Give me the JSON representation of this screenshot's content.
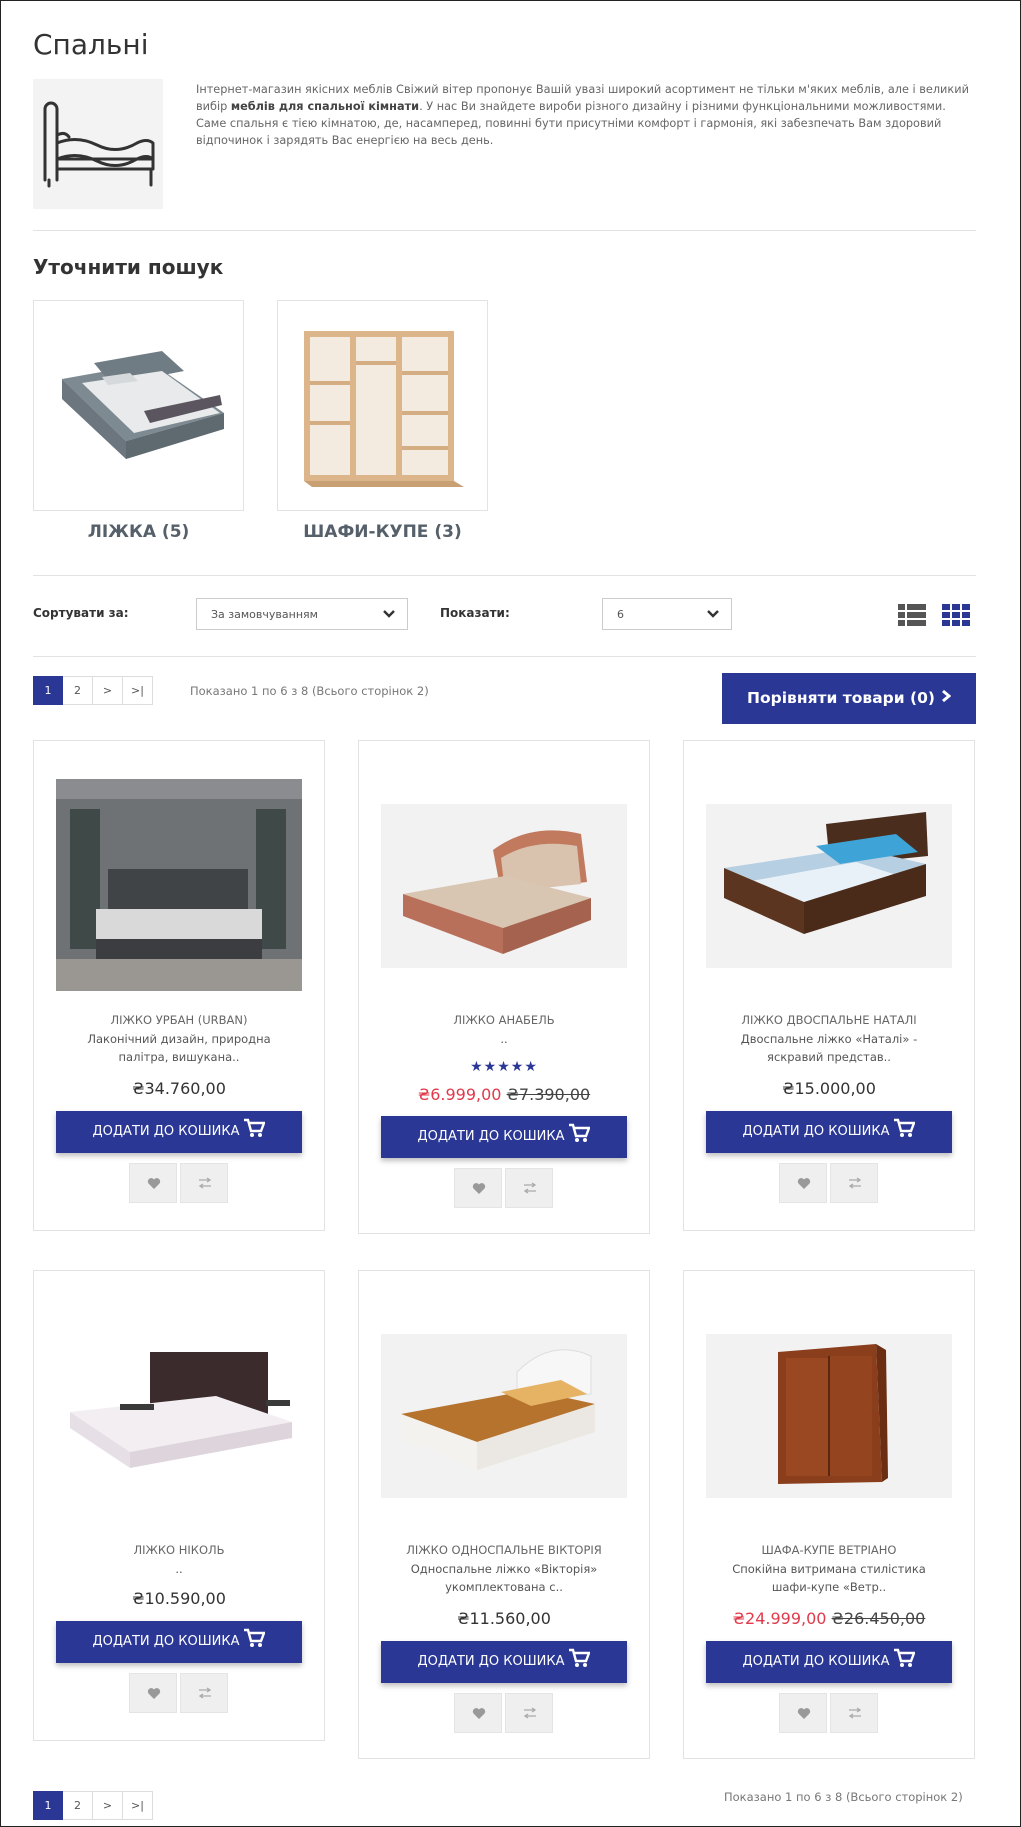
{
  "category": {
    "title": "Спальні",
    "desc_part1": "Інтернет-магазин якісних меблів Свіжий вітер пропонує Вашій увазі широкий асортимент не тільки м'яких меблів, але і великий вибір ",
    "desc_bold": "меблів для спальної кімнати",
    "desc_part2": ". У нас Ви знайдете вироби різного дизайну і різними функціональними можливостями.",
    "desc_para2": "Саме спальня є тією кімнатою, де, насамперед, повинні бути присутніми комфорт і гармонія, які забезпечать Вам здоровий відпочинок і зарядять Вас енергією на весь день."
  },
  "refine": {
    "title": "Уточнити пошук",
    "items": [
      {
        "label": "ЛІЖКА (5)"
      },
      {
        "label": "ШАФИ-КУПЕ (3)"
      }
    ]
  },
  "toolbar": {
    "sort_label": "Сортувати за:",
    "sort_value": "За замовчуванням",
    "limit_label": "Показати:",
    "limit_value": "6"
  },
  "pagination": {
    "pages": [
      "1",
      "2",
      ">",
      ">|"
    ],
    "results_text": "Показано 1 по 6 з 8 (Всього сторінок 2)"
  },
  "compare": {
    "label": "Порівняти товари (0)"
  },
  "cart_label": "ДОДАТИ ДО КОШИКА",
  "products": [
    {
      "name": "ЛІЖКО УРБАН (URBAN)",
      "desc": "Лаконічний дизайн, природна палітра, вишукана..",
      "price": "₴34.760,00"
    },
    {
      "name": "ЛІЖКО АНАБЕЛЬ",
      "desc": "..",
      "stars": "★★★★★",
      "rating": 5,
      "price_new": "₴6.999,00",
      "price_old": "₴7.390,00"
    },
    {
      "name": "ЛІЖКО ДВОСПАЛЬНЕ НАТАЛІ",
      "desc": "Двоспальне ліжко «Наталі» - яскравий представ..",
      "price": "₴15.000,00"
    },
    {
      "name": "ЛІЖКО НІКОЛЬ",
      "desc": "..",
      "price": "₴10.590,00"
    },
    {
      "name": "ЛІЖКО ОДНОСПАЛЬНЕ ВІКТОРІЯ",
      "desc": "Односпальне ліжко «Вікторія» укомплектована с..",
      "price": "₴11.560,00"
    },
    {
      "name": "ШАФА-КУПЕ ВЕТРІАНО",
      "desc": "Спокійна витримана стилістика шафи-купе «Ветр..",
      "price_new": "₴24.999,00",
      "price_old": "₴26.450,00"
    }
  ],
  "colors": {
    "accent": "#2a3795",
    "sale": "#e03a4b"
  },
  "icons": [
    "bed-outline-icon",
    "chevron-down-icon",
    "list-view-icon",
    "grid-view-icon",
    "chevron-right-icon",
    "cart-icon",
    "heart-icon",
    "compare-icon"
  ]
}
